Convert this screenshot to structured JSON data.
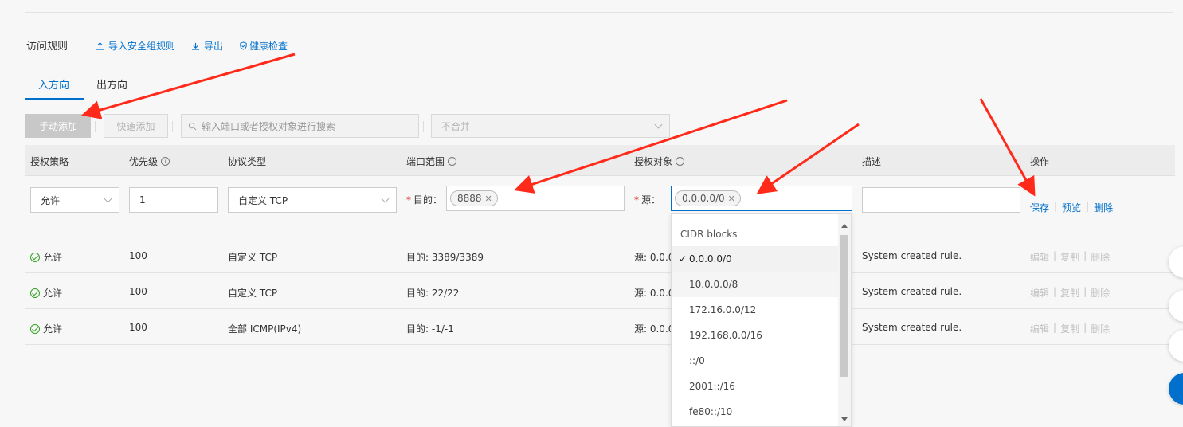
{
  "header": {
    "section_title": "访问规则",
    "import_label": "导入安全组规则",
    "export_label": "导出",
    "health_label": "健康检查"
  },
  "tabs": [
    {
      "label": "入方向",
      "active": true
    },
    {
      "label": "出方向",
      "active": false
    }
  ],
  "toolbar": {
    "manual_add": "手动添加",
    "quick_add": "快速添加",
    "search_placeholder": "输入端口或者授权对象进行搜索",
    "merge_select": "不合并"
  },
  "columns": [
    "授权策略",
    "优先级",
    "协议类型",
    "端口范围",
    "授权对象",
    "描述",
    "操作"
  ],
  "edit_row": {
    "policy": "允许",
    "priority": "1",
    "protocol": "自定义 TCP",
    "dest_label": "目的：",
    "dest_tag": "8888",
    "source_label": "源：",
    "source_tag": "0.0.0.0/0",
    "description": "",
    "ops": {
      "save": "保存",
      "preview": "预览",
      "delete": "删除"
    }
  },
  "rows": [
    {
      "policy": "允许",
      "priority": "100",
      "protocol": "自定义 TCP",
      "port": "目的: 3389/3389",
      "source": "源: 0.0.0.",
      "desc": "System created rule.",
      "ops": [
        "编辑",
        "复制",
        "删除"
      ]
    },
    {
      "policy": "允许",
      "priority": "100",
      "protocol": "自定义 TCP",
      "port": "目的: 22/22",
      "source": "源: 0.0.0.",
      "desc": "System created rule.",
      "ops": [
        "编辑",
        "复制",
        "删除"
      ]
    },
    {
      "policy": "允许",
      "priority": "100",
      "protocol": "全部 ICMP(IPv4)",
      "port": "目的: -1/-1",
      "source": "源: 0.0.0.",
      "desc": "System created rule.",
      "ops": [
        "编辑",
        "复制",
        "删除"
      ]
    }
  ],
  "dropdown": {
    "header": "CIDR blocks",
    "items": [
      "0.0.0.0/0",
      "10.0.0.0/8",
      "172.16.0.0/12",
      "192.168.0.0/16",
      "::/0",
      "2001::/16",
      "fe80::/10"
    ],
    "selected": "0.0.0.0/0",
    "check": "✓"
  },
  "colors": {
    "accent": "#0070cc",
    "annotation": "#ff2a1a",
    "success": "#2ea121"
  },
  "icons": [
    "upload-icon",
    "download-icon",
    "shield-icon",
    "search-icon",
    "info-icon",
    "check-circle-icon",
    "chevron-down-icon"
  ]
}
